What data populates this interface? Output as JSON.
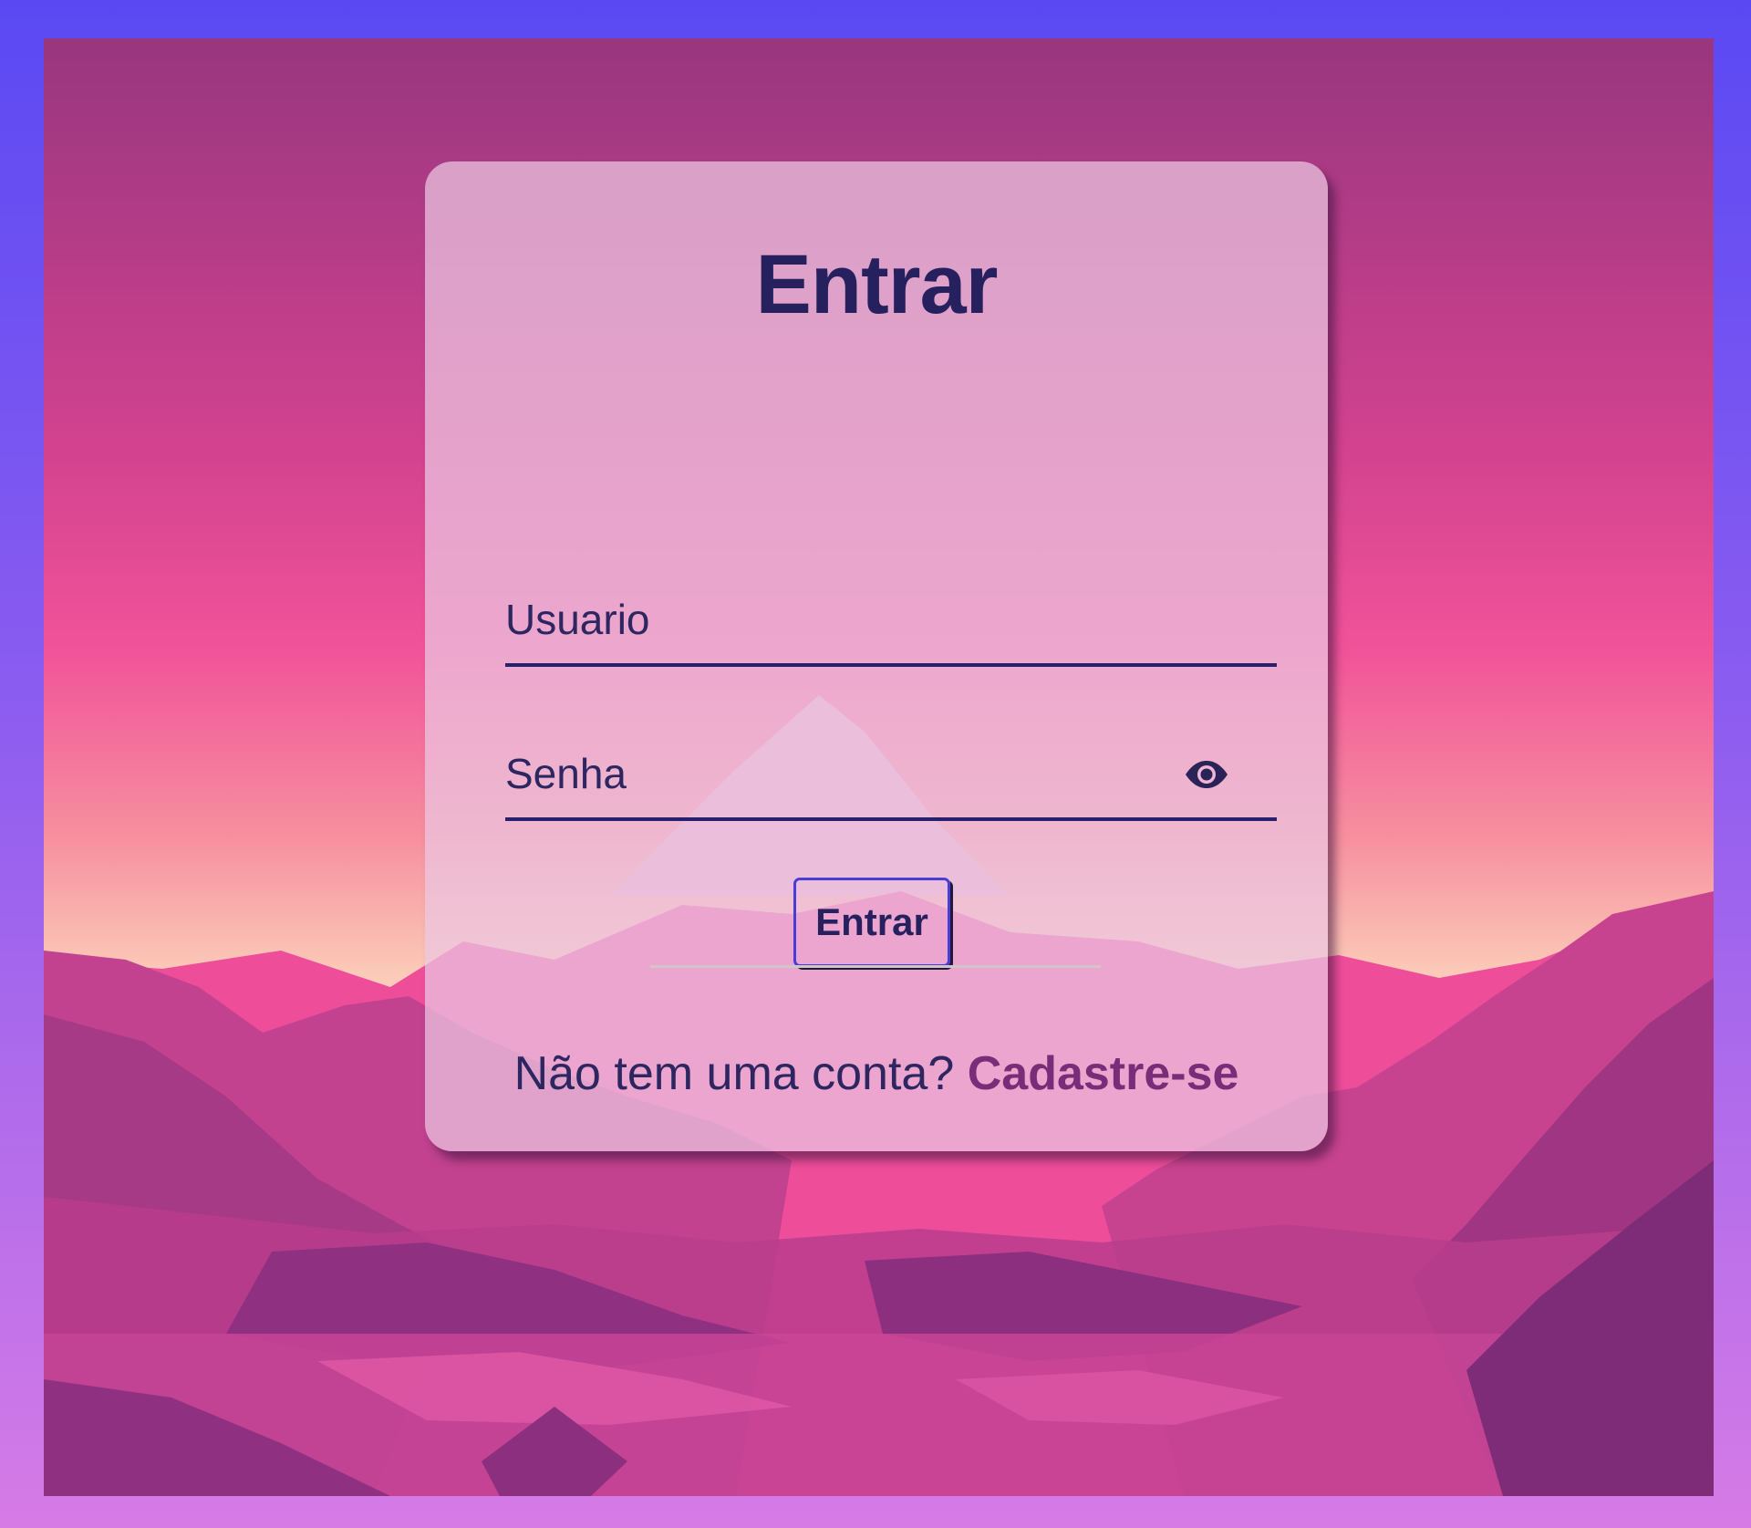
{
  "login": {
    "title": "Entrar",
    "username_placeholder": "Usuario",
    "password_placeholder": "Senha",
    "password_toggle_icon": "eye-icon",
    "submit_label": "Entrar",
    "signup_prompt": "Não tem uma conta? ",
    "signup_link": "Cadastre-se"
  },
  "colors": {
    "frame_top": "#5a49f3",
    "frame_bottom": "#d67be6",
    "sky_top": "#9e3b83",
    "sky_mid": "#ef4f98",
    "horizon": "#fbd3c1",
    "title": "#26215e",
    "link": "#7a2c79",
    "button_border": "#4a3dd6"
  }
}
